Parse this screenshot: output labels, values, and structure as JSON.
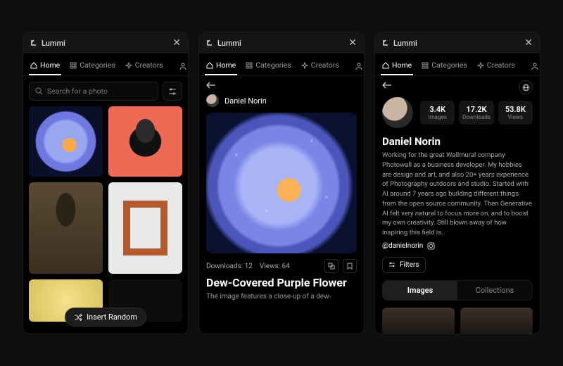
{
  "brand": "Lummi",
  "tabs": {
    "home": "Home",
    "categories": "Categories",
    "creators": "Creators"
  },
  "panel_home": {
    "search_placeholder": "Search for a photo",
    "insert_random": "Insert Random"
  },
  "panel_detail": {
    "author": "Daniel Norin",
    "downloads_label": "Downloads:",
    "downloads_value": "12",
    "views_label": "Views:",
    "views_value": "64",
    "title": "Dew-Covered Purple Flower",
    "description": "The image features a close-up of a dew-"
  },
  "panel_profile": {
    "name": "Daniel Norin",
    "stats": [
      {
        "num": "3.4K",
        "lbl": "Images"
      },
      {
        "num": "17.2K",
        "lbl": "Downloads"
      },
      {
        "num": "53.8K",
        "lbl": "Views"
      }
    ],
    "bio": "Working for the great Wallmural company Photowall as a business developer. My hobbies are design and art, and also 20+ years experience of Photography outdoors and studio. Started with AI around 7 years ago building different things from the open source community. Then Generative AI felt very natural to focus more on, and to boost my own creativity. Still blown away of how inspiring this field is.",
    "handle": "@danielnorin",
    "filters": "Filters",
    "seg_images": "Images",
    "seg_collections": "Collections"
  }
}
